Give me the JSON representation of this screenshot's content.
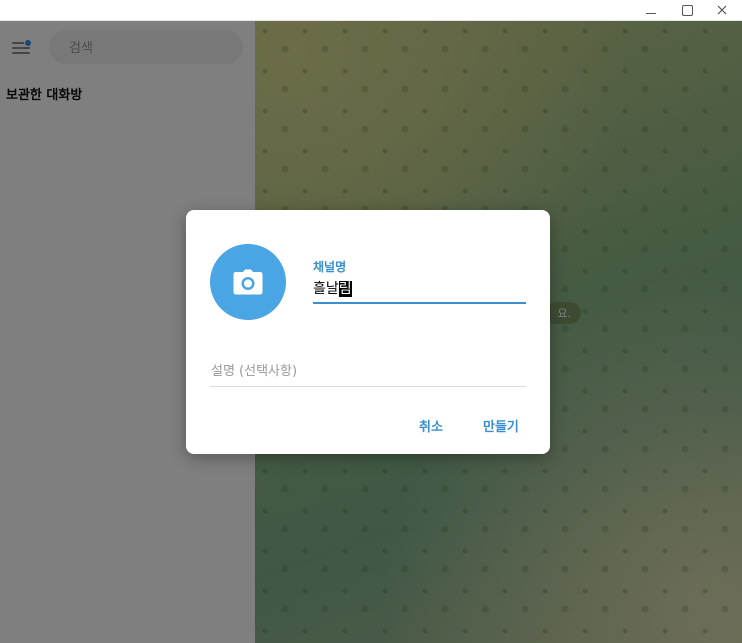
{
  "window": {
    "controls": [
      "minimize",
      "maximize",
      "close"
    ]
  },
  "sidebar": {
    "search_placeholder": "검색",
    "archived_label": "보관한 대화방"
  },
  "chat": {
    "bubble_text": "요."
  },
  "dialog": {
    "name_label": "채널명",
    "name_value_plain": "흘날",
    "name_value_selected": "림",
    "description_placeholder": "설명 (선택사항)",
    "cancel_label": "취소",
    "create_label": "만들기"
  },
  "colors": {
    "accent": "#3a8fd2",
    "avatar_bg": "#49a5e3",
    "notification_dot": "#3390ec"
  }
}
